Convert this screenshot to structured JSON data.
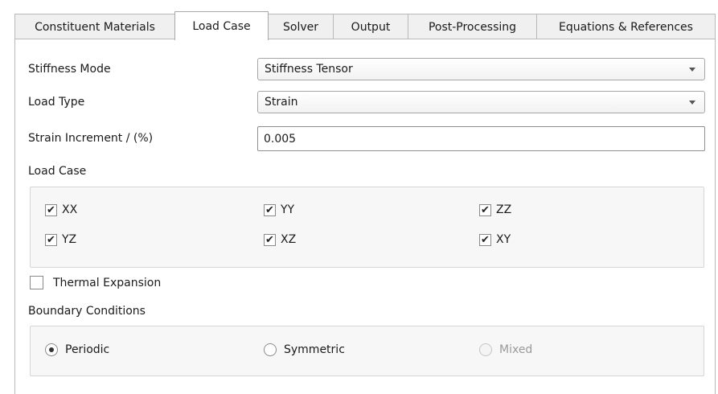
{
  "tabs": [
    {
      "label": "Constituent Materials"
    },
    {
      "label": "Load Case"
    },
    {
      "label": "Solver"
    },
    {
      "label": "Output"
    },
    {
      "label": "Post-Processing"
    },
    {
      "label": "Equations & References"
    }
  ],
  "active_tab": "Load Case",
  "stiffness_mode": {
    "label": "Stiffness Mode",
    "value": "Stiffness Tensor"
  },
  "load_type": {
    "label": "Load Type",
    "value": "Strain"
  },
  "strain_increment": {
    "label": "Strain Increment / (%)",
    "value": "0.005"
  },
  "load_case": {
    "label": "Load Case",
    "options": [
      {
        "label": "XX",
        "checked": true
      },
      {
        "label": "YY",
        "checked": true
      },
      {
        "label": "ZZ",
        "checked": true
      },
      {
        "label": "YZ",
        "checked": true
      },
      {
        "label": "XZ",
        "checked": true
      },
      {
        "label": "XY",
        "checked": true
      }
    ]
  },
  "thermal_expansion": {
    "label": "Thermal Expansion",
    "checked": false
  },
  "boundary_conditions": {
    "label": "Boundary Conditions",
    "options": [
      {
        "label": "Periodic",
        "selected": true,
        "enabled": true
      },
      {
        "label": "Symmetric",
        "selected": false,
        "enabled": true
      },
      {
        "label": "Mixed",
        "selected": false,
        "enabled": false
      }
    ]
  },
  "check_glyph": "✔"
}
